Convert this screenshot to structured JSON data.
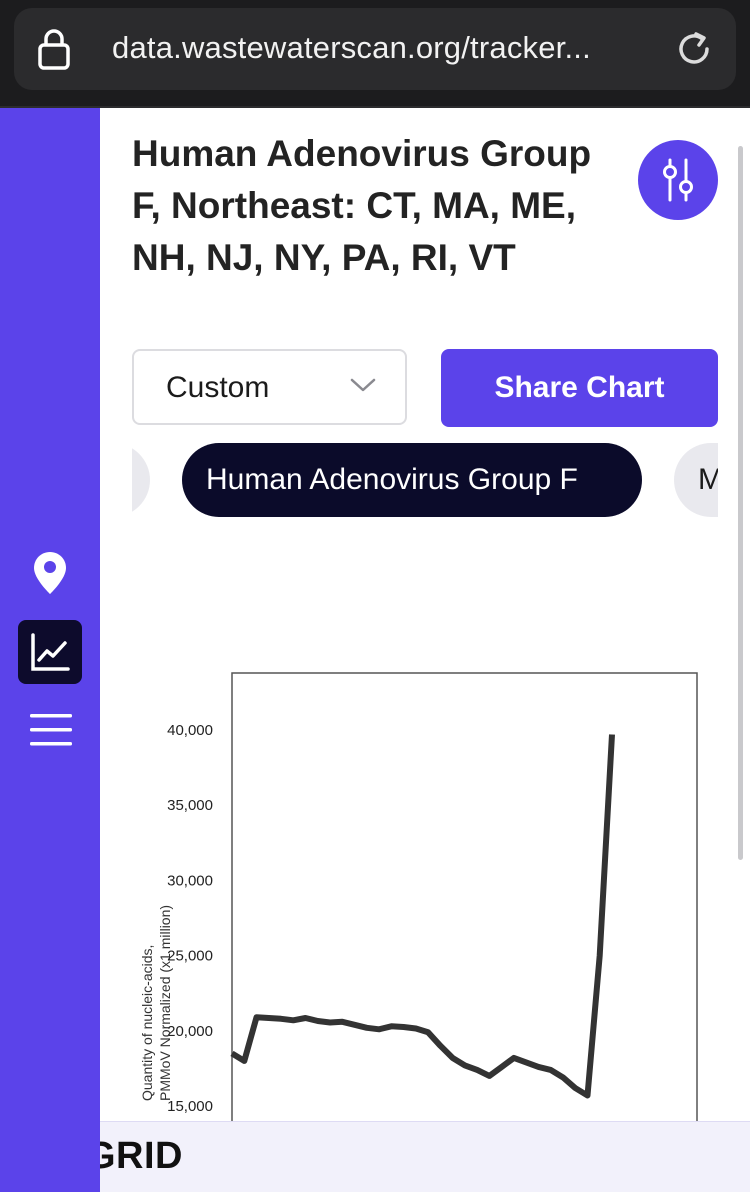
{
  "browser": {
    "url": "data.wastewaterscan.org/tracker..."
  },
  "sidebar": {
    "items": [
      {
        "name": "map",
        "icon": "map-pin-icon",
        "active": false
      },
      {
        "name": "chart",
        "icon": "line-chart-icon",
        "active": true
      },
      {
        "name": "menu",
        "icon": "hamburger-menu-icon",
        "active": false
      }
    ],
    "accent": "#5b43ea"
  },
  "header": {
    "title": "Human Adenovirus Group F, Northeast: CT, MA, ME, NH, NJ, NY, PA, RI, VT",
    "filter_icon": "sliders-icon"
  },
  "controls": {
    "range_value": "Custom",
    "share_label": "Share Chart"
  },
  "chips": {
    "active": "Human Adenovirus Group F",
    "next_partial": "M"
  },
  "chart_data": {
    "type": "line",
    "ylabel": "Quantity of nucleic-acids, PMMoV Normalized (x1 million)",
    "yticks": [
      "40,000",
      "35,000",
      "30,000",
      "25,000",
      "20,000",
      "15,000"
    ],
    "ylim": [
      15000,
      43000
    ],
    "series": [
      {
        "color": "#333333",
        "x": [
          0,
          1,
          2,
          3,
          4,
          5,
          6,
          7,
          8,
          9,
          10,
          11,
          12,
          13,
          14,
          15,
          16,
          17,
          18,
          19,
          20,
          21,
          22,
          23,
          24,
          25,
          26,
          27,
          28,
          29,
          30,
          31
        ],
        "values": [
          18500,
          18000,
          20900,
          20850,
          20800,
          20700,
          20850,
          20650,
          20550,
          20600,
          20400,
          20200,
          20100,
          20300,
          20250,
          20150,
          19900,
          19000,
          18200,
          17700,
          17400,
          17000,
          17600,
          18200,
          17900,
          17600,
          17400,
          16900,
          16200,
          15700,
          25000,
          39700
        ]
      }
    ]
  },
  "footer": {
    "brand": "GRID"
  }
}
